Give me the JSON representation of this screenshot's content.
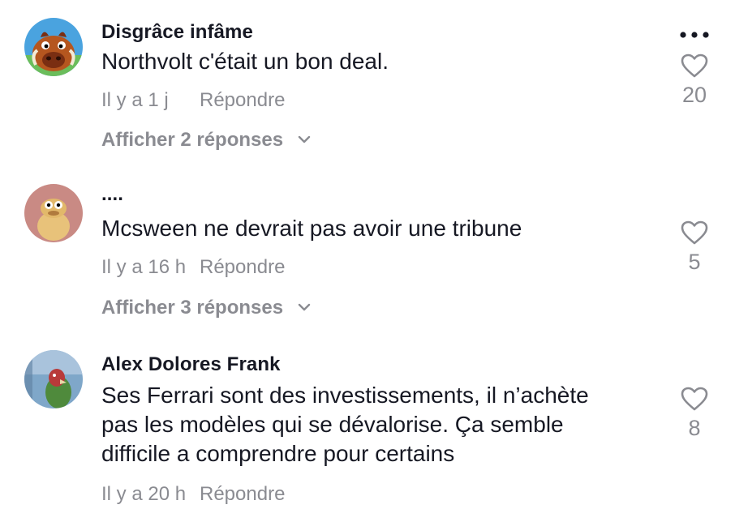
{
  "comments": [
    {
      "username": "Disgrâce infâme",
      "text": "Northvolt c'était un bon deal.",
      "time": "Il y a 1 j",
      "reply_label": "Répondre",
      "likes": "20",
      "replies_label": "Afficher 2 réponses"
    },
    {
      "username": "....",
      "text": "Mcsween ne devrait pas avoir une tribune",
      "time": "Il y a 16 h",
      "reply_label": "Répondre",
      "likes": "5",
      "replies_label": "Afficher 3 réponses"
    },
    {
      "username": "Alex Dolores Frank",
      "text": "Ses Ferrari sont des investissements, il n’achète\npas les modèles qui se dévalorise. Ça semble\ndifficile a comprendre pour certains",
      "time": "Il y a 20 h",
      "reply_label": "Répondre",
      "likes": "8"
    }
  ],
  "icons": {
    "more": "more-options-icon",
    "like": "heart-outline-icon",
    "expand": "chevron-down-icon"
  },
  "colors": {
    "text_primary": "#161823",
    "text_secondary": "#8a8b91",
    "icon_gray": "#8a8b91"
  }
}
